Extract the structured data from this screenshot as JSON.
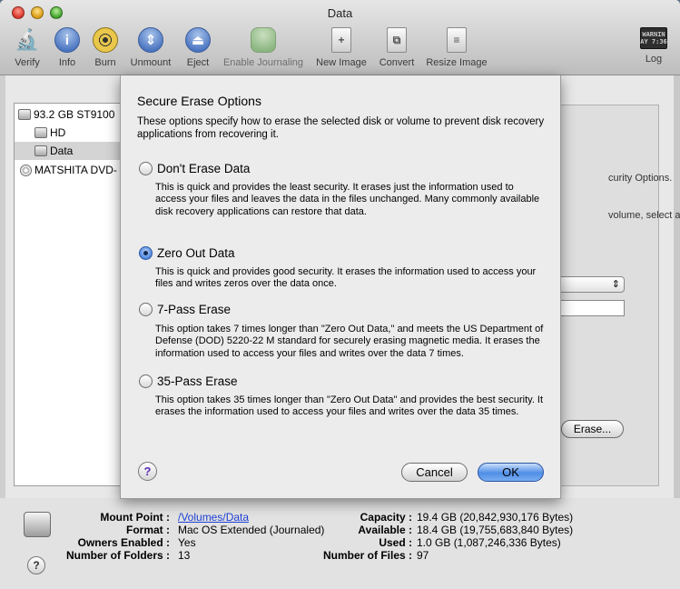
{
  "window": {
    "title": "Data"
  },
  "toolbar": {
    "items": [
      {
        "id": "verify",
        "label": "Verify",
        "icon": "microscope-icon",
        "enabled": true
      },
      {
        "id": "info",
        "label": "Info",
        "icon": "info-icon",
        "glyph": "i",
        "enabled": true
      },
      {
        "id": "burn",
        "label": "Burn",
        "icon": "burn-icon",
        "enabled": true
      },
      {
        "id": "unmount",
        "label": "Unmount",
        "icon": "unmount-icon",
        "glyph": "⇕",
        "enabled": true
      },
      {
        "id": "eject",
        "label": "Eject",
        "icon": "eject-icon",
        "glyph": "⏏",
        "enabled": true
      },
      {
        "id": "enable-journaling",
        "label": "Enable Journaling",
        "icon": "journaling-icon",
        "enabled": false
      },
      {
        "id": "new-image",
        "label": "New Image",
        "icon": "new-image-icon",
        "enabled": true
      },
      {
        "id": "convert",
        "label": "Convert",
        "icon": "convert-icon",
        "enabled": true
      },
      {
        "id": "resize-image",
        "label": "Resize Image",
        "icon": "resize-image-icon",
        "enabled": true
      },
      {
        "id": "log",
        "label": "Log",
        "icon": "log-icon",
        "glyph": "WARNIN\nAY 7:36",
        "enabled": true
      }
    ]
  },
  "sidebar": {
    "items": [
      {
        "label": "93.2 GB ST9100",
        "indent": 0,
        "selected": false,
        "type": "disk"
      },
      {
        "label": "HD",
        "indent": 1,
        "selected": false,
        "type": "volume"
      },
      {
        "label": "Data",
        "indent": 1,
        "selected": true,
        "type": "volume"
      },
      {
        "label": "MATSHITA DVD-",
        "indent": 0,
        "selected": false,
        "type": "optical"
      }
    ]
  },
  "panel": {
    "help_line_1": "curity Options.",
    "help_line_2": "volume, select a",
    "erase_button": "Erase..."
  },
  "sheet": {
    "title": "Secure Erase Options",
    "intro": "These options specify how to erase the selected disk or volume to prevent disk recovery applications from recovering it.",
    "options": [
      {
        "label": "Don't Erase Data",
        "selected": false,
        "description": "This is quick and provides the least security. It erases just the information used to access your files and leaves the data in the files unchanged. Many commonly available disk recovery applications can restore that data."
      },
      {
        "label": "Zero Out Data",
        "selected": true,
        "description": "This is quick and provides good security. It erases the information used to access your files and writes zeros over the data once."
      },
      {
        "label": "7-Pass Erase",
        "selected": false,
        "description": "This option takes 7 times longer than \"Zero Out Data,\" and meets the US Department of Defense (DOD) 5220-22 M standard for securely erasing magnetic media. It erases the information used to access your files and writes over the data 7 times."
      },
      {
        "label": "35-Pass Erase",
        "selected": false,
        "description": "This option takes 35 times longer than \"Zero Out Data\" and provides the best security. It erases the information used to access your files and writes over the data 35 times."
      }
    ],
    "help_glyph": "?",
    "cancel_label": "Cancel",
    "ok_label": "OK"
  },
  "info": {
    "help_glyph": "?",
    "left": [
      {
        "label": "Mount Point :",
        "value": "/Volumes/Data",
        "link": true
      },
      {
        "label": "Format :",
        "value": "Mac OS Extended (Journaled)"
      },
      {
        "label": "Owners Enabled :",
        "value": "Yes"
      },
      {
        "label": "Number of Folders :",
        "value": "13"
      }
    ],
    "right": [
      {
        "label": "Capacity :",
        "value": "19.4 GB (20,842,930,176 Bytes)"
      },
      {
        "label": "Available :",
        "value": "18.4 GB (19,755,683,840 Bytes)"
      },
      {
        "label": "Used :",
        "value": "1.0 GB (1,087,246,336 Bytes)"
      },
      {
        "label": "Number of Files :",
        "value": "97"
      }
    ]
  }
}
